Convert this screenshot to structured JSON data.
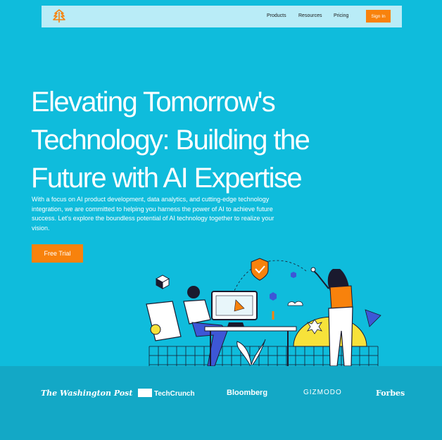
{
  "nav": {
    "logo": "brand-logo",
    "links": [
      "Products",
      "Resources",
      "Pricing"
    ],
    "signin_label": "Sign In"
  },
  "hero": {
    "title_lines": [
      "Elevating Tomorrow's",
      "Technology: Building the",
      "Future with AI Expertise"
    ],
    "description": "With a focus on AI product development, data analytics, and cutting-edge technology integration, we are committed to helping you harness the power of AI to achieve future success. Let's explore the boundless potential of AI technology together to realize your vision.",
    "cta_label": "Free Trial"
  },
  "press_logos": [
    "The Washington Post",
    "TechCrunch",
    "Bloomberg",
    "GIZMODO",
    "Forbes"
  ],
  "colors": {
    "background": "#0fbcdc",
    "navbar": "#b9ecf7",
    "accent": "#f8820c",
    "logos_bar": "#13a8c6",
    "illustration_yellow": "#f7e23a",
    "illustration_blue": "#3d57d6"
  }
}
